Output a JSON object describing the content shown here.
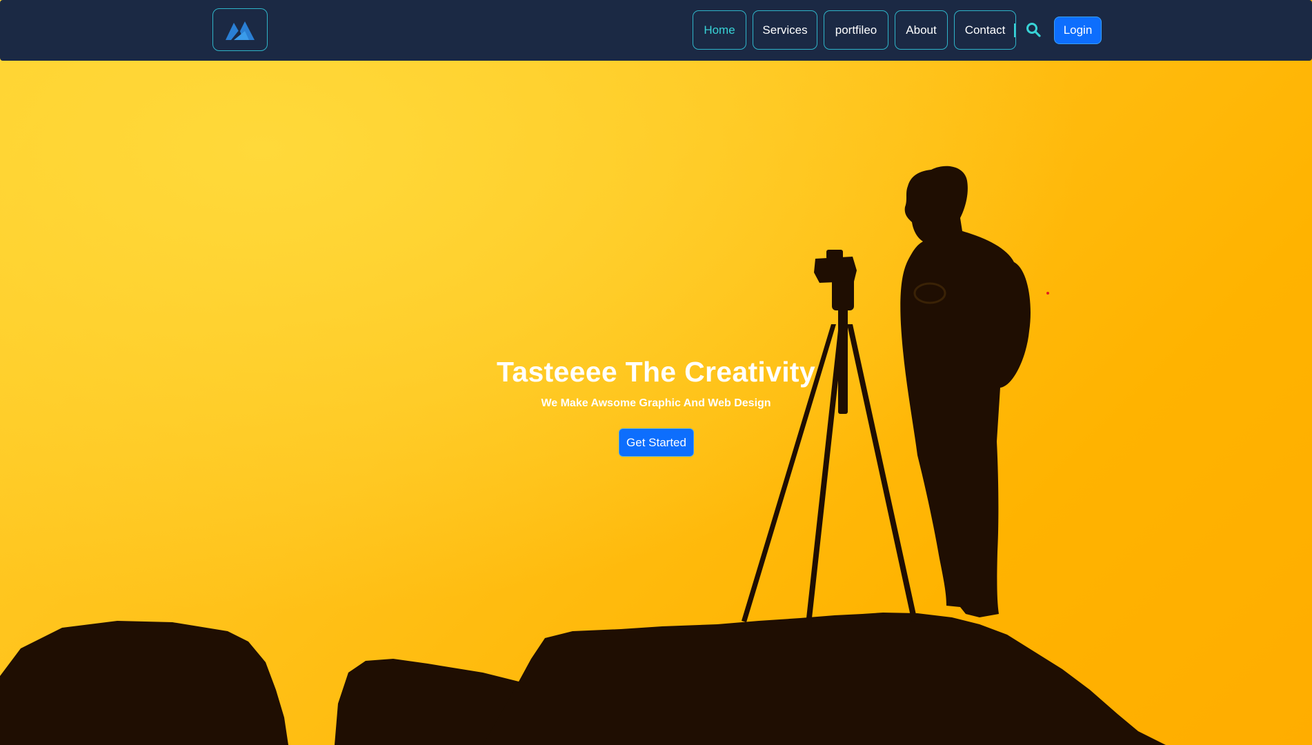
{
  "navbar": {
    "logo_icon": "brand-logo-icon",
    "links": [
      {
        "label": "Home",
        "active": true
      },
      {
        "label": "Services",
        "active": false
      },
      {
        "label": "portfileo",
        "active": false
      },
      {
        "label": "About",
        "active": false
      },
      {
        "label": "Contact",
        "active": false
      }
    ],
    "search_icon": "search-icon",
    "login_label": "Login"
  },
  "hero": {
    "title": "Tasteeee The Creativity",
    "subtitle": "We Make Awsome Graphic And Web Design",
    "cta_label": "Get Started",
    "background_image": "photographer-silhouette-with-tripod-on-rocks-at-sunset"
  },
  "colors": {
    "navbar_bg": "#1b2944",
    "accent": "#38d3d6",
    "border": "#2fb5c9",
    "button": "#0d6efd",
    "hero_bg": "#ffb300"
  }
}
